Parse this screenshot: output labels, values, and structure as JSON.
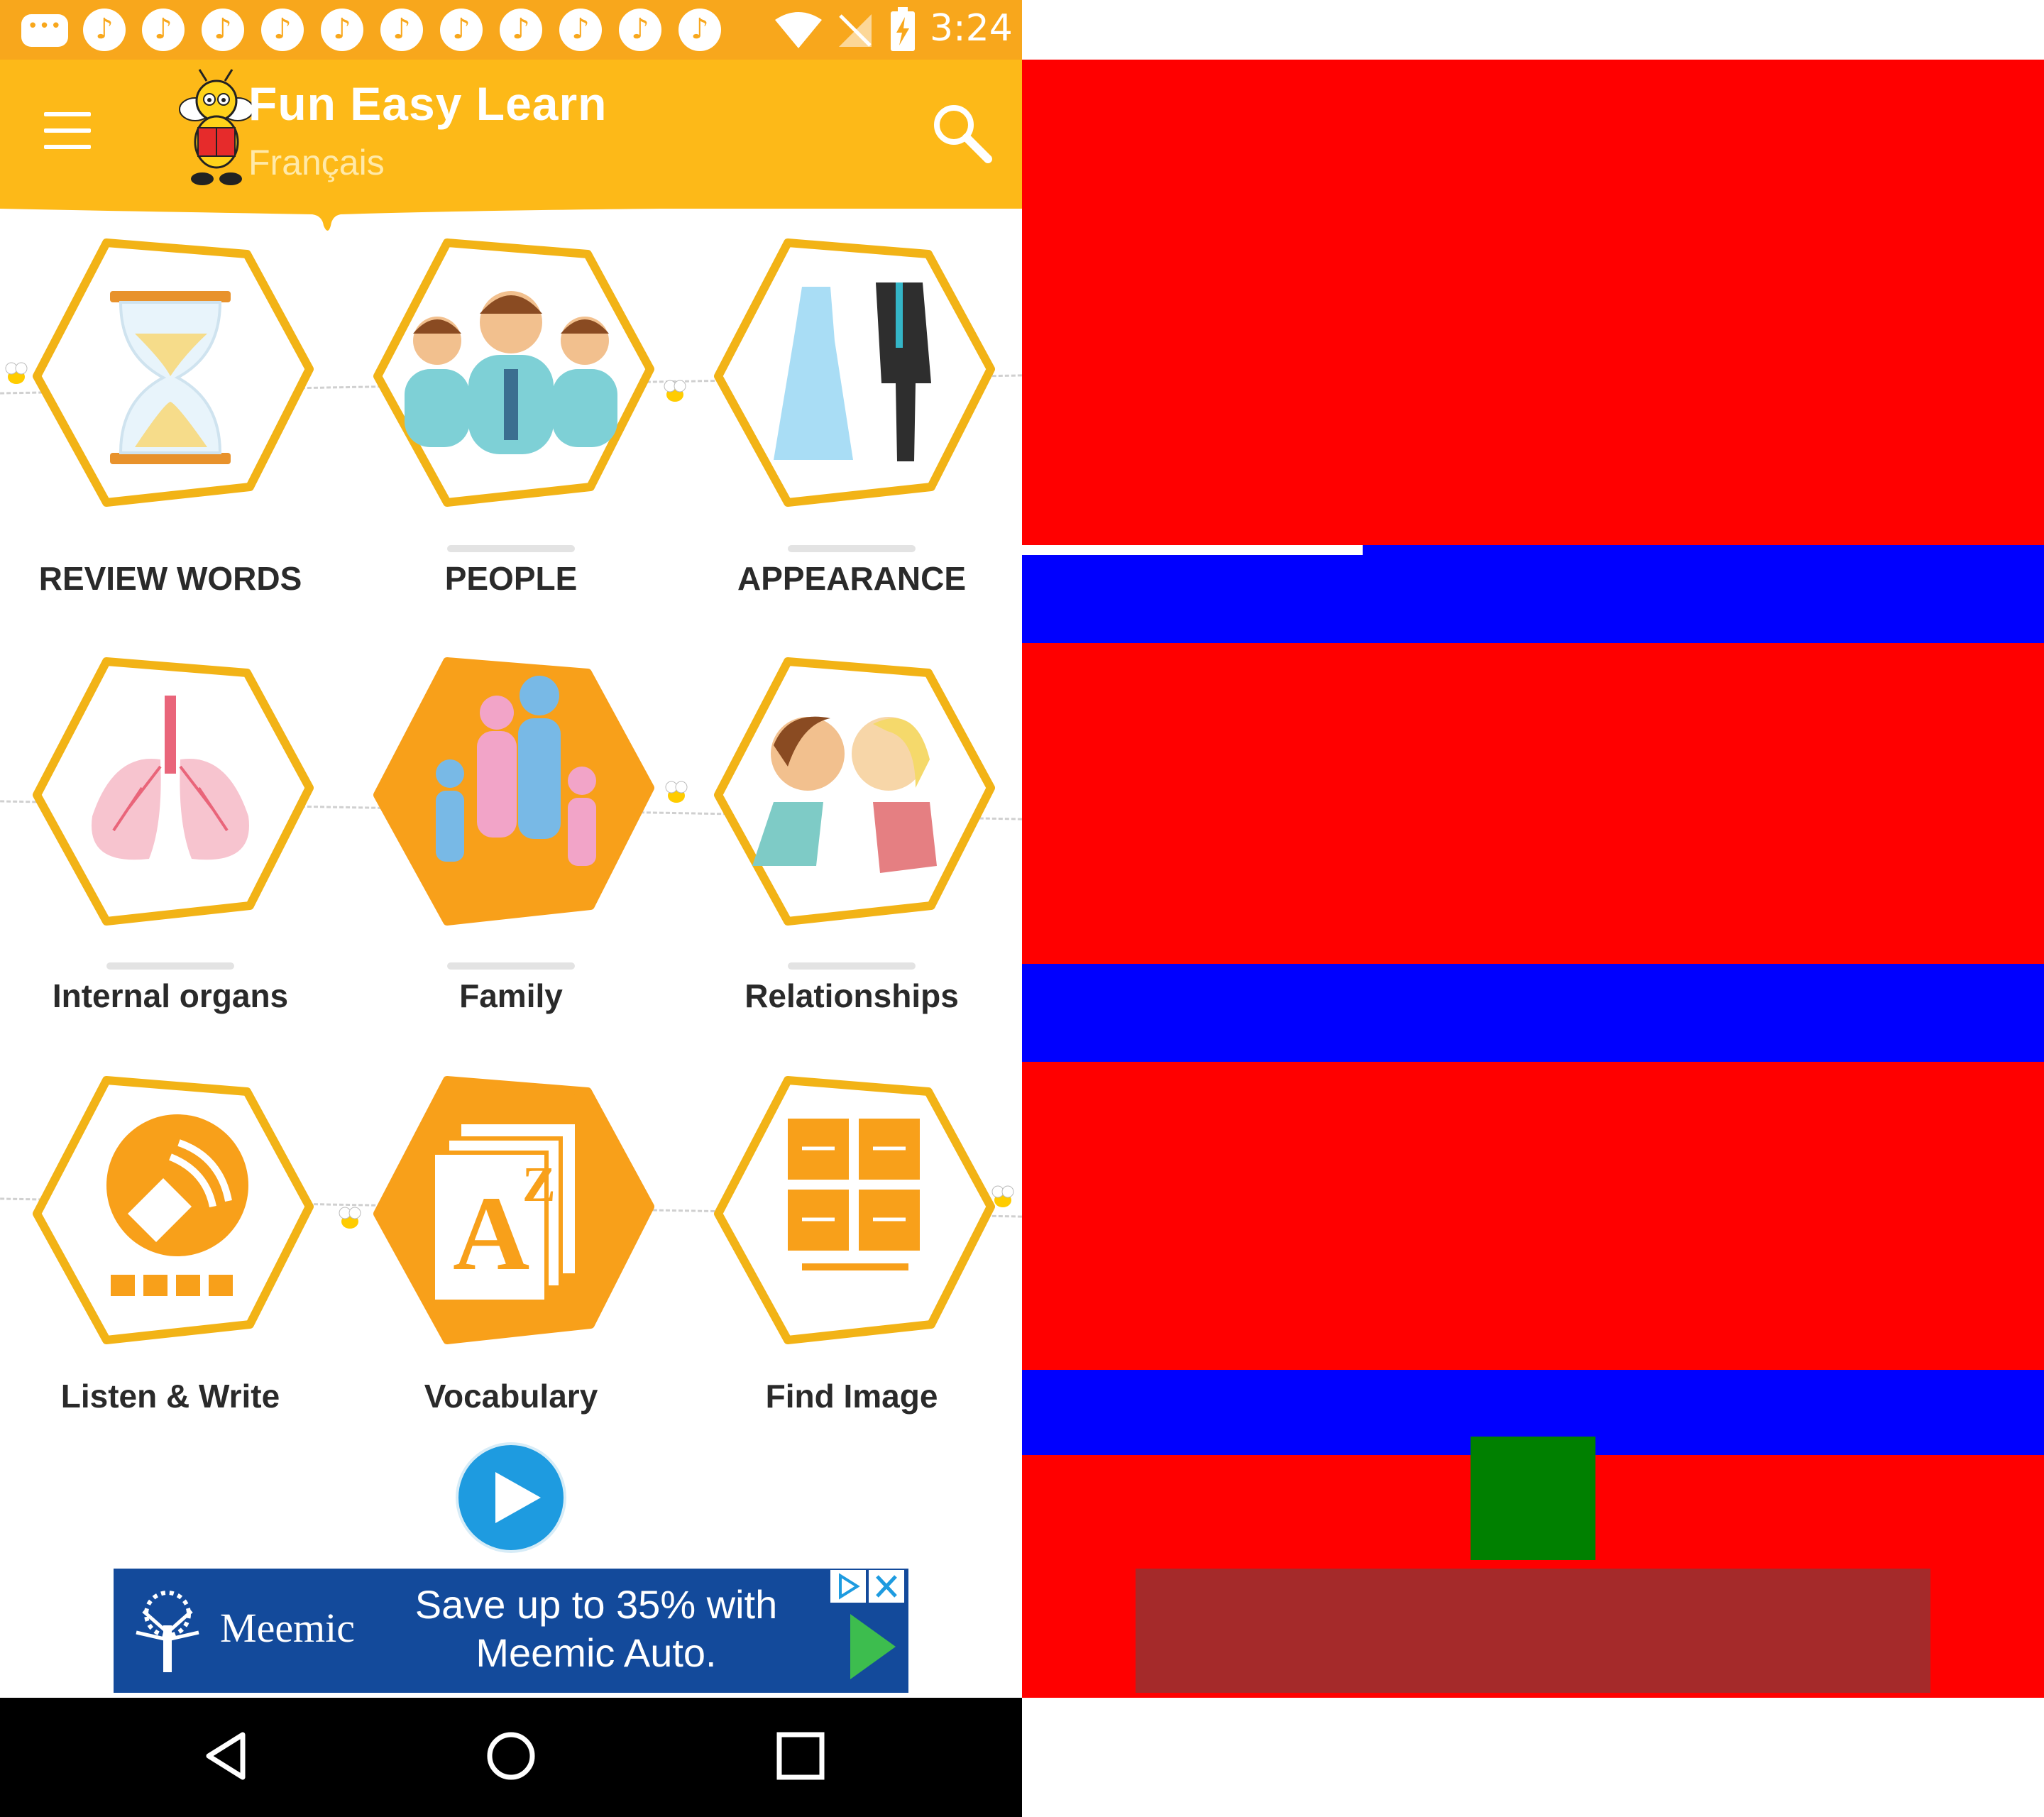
{
  "status_bar": {
    "time": "3:24",
    "notification_icons": [
      "chat-notification-icon",
      "music-note-icon",
      "music-note-icon",
      "music-note-icon",
      "music-note-icon",
      "music-note-icon",
      "music-note-icon",
      "music-note-icon",
      "music-note-icon",
      "music-note-icon",
      "music-note-icon",
      "music-note-icon"
    ],
    "system_icons": [
      "wifi-icon",
      "no-signal-icon",
      "battery-charging-icon"
    ]
  },
  "app_bar": {
    "title": "Fun Easy Learn",
    "subtitle": "Français",
    "menu_icon": "hamburger-menu-icon",
    "logo_icon": "bee-reading-book-icon",
    "search_icon": "magnifier-icon",
    "color": "#fdb918"
  },
  "tiles": [
    {
      "label": "REVIEW WORDS",
      "icon": "hourglass-icon",
      "style": "outline"
    },
    {
      "label": "PEOPLE",
      "icon": "people-group-icon",
      "style": "outline"
    },
    {
      "label": "APPEARANCE",
      "icon": "dress-and-suit-icon",
      "style": "outline"
    },
    {
      "label": "Internal organs",
      "icon": "lungs-icon",
      "style": "outline"
    },
    {
      "label": "Family",
      "icon": "family-icon",
      "style": "filled"
    },
    {
      "label": "Relationships",
      "icon": "couple-kissing-icon",
      "style": "outline"
    },
    {
      "label": "Listen & Write",
      "icon": "speaker-keyboard-icon",
      "style": "outline"
    },
    {
      "label": "Vocabulary",
      "icon": "az-dictionary-icon",
      "style": "filled"
    },
    {
      "label": "Find Image",
      "icon": "image-grid-icon",
      "style": "outline"
    }
  ],
  "play_button": {
    "icon": "play-icon",
    "color": "#1e9be0"
  },
  "ad": {
    "brand": "Meemic",
    "line1": "Save up to 35% with",
    "line2": "Meemic Auto.",
    "icons": [
      "tree-logo-icon",
      "ad-choices-icon",
      "ad-close-icon",
      "green-arrow-icon"
    ],
    "background": "#134a9b"
  },
  "nav_bar": {
    "icons": [
      "back-triangle-icon",
      "home-circle-icon",
      "recents-square-icon"
    ]
  },
  "colors": {
    "accent_orange": "#f8a71c",
    "hex_outline": "#f2b316",
    "hex_fill": "#f8a01a",
    "mask_red": "#ff0000",
    "mask_blue": "#0000ff",
    "mask_green": "#008000",
    "mask_brown": "#a52a2a"
  }
}
